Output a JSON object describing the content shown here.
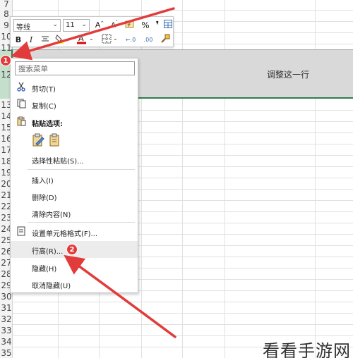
{
  "sheet": {
    "row_numbers": [
      "7",
      "8",
      "9",
      "10",
      "11",
      "12",
      "13",
      "14",
      "15",
      "16",
      "17",
      "18",
      "19",
      "20",
      "21",
      "22",
      "23",
      "24",
      "25",
      "26",
      "27",
      "28",
      "29",
      "30",
      "31",
      "32",
      "33",
      "34",
      "35"
    ],
    "selected_row_text": "调整这一行"
  },
  "mini_toolbar": {
    "font_name": "等线",
    "font_size": "11",
    "bold_label": "B",
    "italic_label": "I",
    "percent_label": "%",
    "comma_label": "❜",
    "increase_decimal_label": "←.0",
    "decrease_decimal_label": ".00"
  },
  "context_menu": {
    "search_placeholder": "搜索菜单",
    "items": {
      "cut": "剪切(T)",
      "copy": "复制(C)",
      "paste_options": "粘贴选项:",
      "paste_special": "选择性粘贴(S)...",
      "insert": "插入(I)",
      "delete": "删除(D)",
      "clear_contents": "清除内容(N)",
      "format_cells": "设置单元格格式(F)...",
      "row_height": "行高(R)...",
      "hide": "隐藏(H)",
      "unhide": "取消隐藏(U)"
    }
  },
  "badges": {
    "first": "1",
    "second": "2"
  },
  "colors": {
    "accent_green": "#2e7d4f",
    "callout_red": "#e23b3b"
  },
  "watermark": "看看手游网"
}
